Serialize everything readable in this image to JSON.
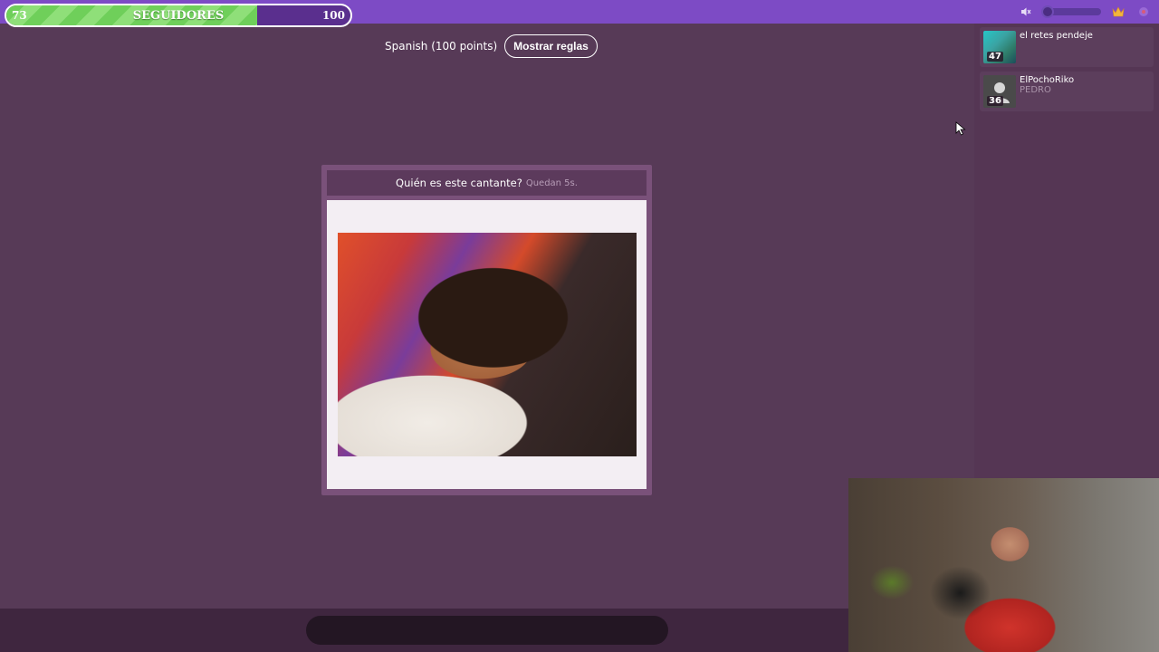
{
  "follower_goal": {
    "label": "SEGUIDORES",
    "current": "73",
    "goal": "100",
    "progress_fraction": 0.73
  },
  "top_controls": {
    "mute_icon": "speaker-muted-icon",
    "volume_fraction": 0.0,
    "crown_icon": "crown-icon",
    "extra_icon": "settings-icon"
  },
  "game": {
    "language_points": "Spanish (100 points)",
    "rules_button": "Mostrar reglas"
  },
  "question": {
    "text": "Quién es este cantante?",
    "timer": "Quedan 5s."
  },
  "players": [
    {
      "name": "el retes pendeje",
      "subtitle": "",
      "score": "47",
      "avatar": "photo-avatar"
    },
    {
      "name": "ElPochoRiko",
      "subtitle": "PEDRO",
      "score": "36",
      "avatar": "default-user-avatar"
    }
  ],
  "answer_input": {
    "value": "",
    "placeholder": ""
  },
  "colors": {
    "background": "#573a57",
    "topbar": "#7d4bc5",
    "progress_fill": "#6fcf5a",
    "card": "#7a517a"
  }
}
